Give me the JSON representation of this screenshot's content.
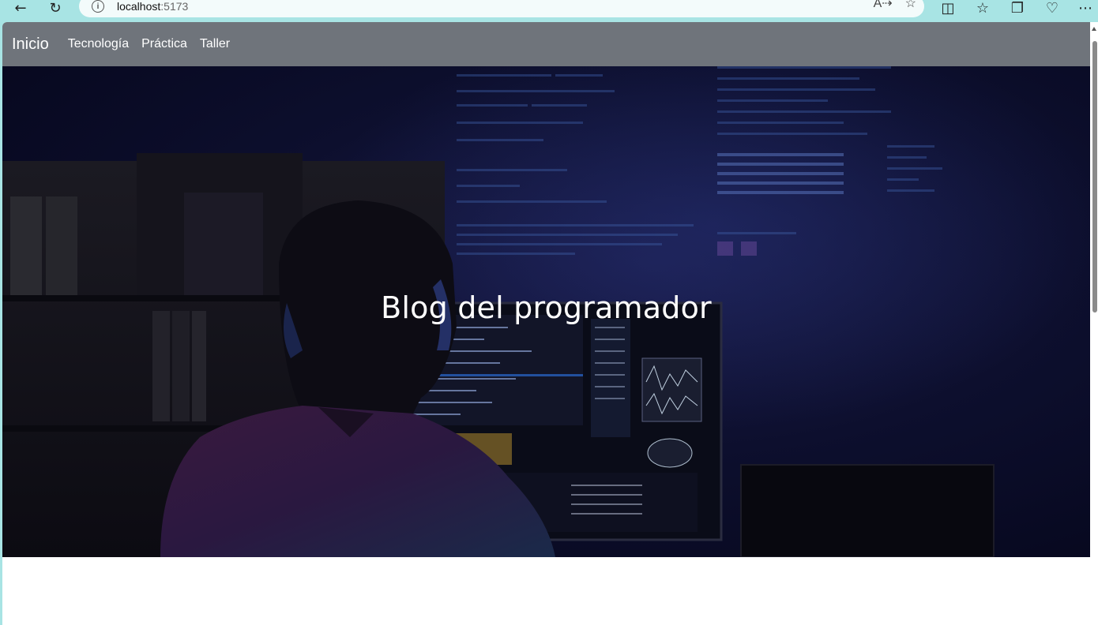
{
  "browser": {
    "url_host": "localhost",
    "url_port": ":5173",
    "icons": [
      "back-icon",
      "refresh-icon",
      "info-icon",
      "read-aloud-icon",
      "favorite-icon",
      "split-screen-icon",
      "favorites-list-icon",
      "collections-icon",
      "browser-health-icon",
      "more-icon"
    ]
  },
  "navbar": {
    "brand": "Inicio",
    "links": [
      "Tecnología",
      "Práctica",
      "Taller"
    ]
  },
  "hero": {
    "title": "Blog del programador"
  },
  "colors": {
    "navbar_bg": "#6f747b",
    "hero_bg": "#0d0f2e",
    "browser_chrome": "#a8e4e4"
  }
}
